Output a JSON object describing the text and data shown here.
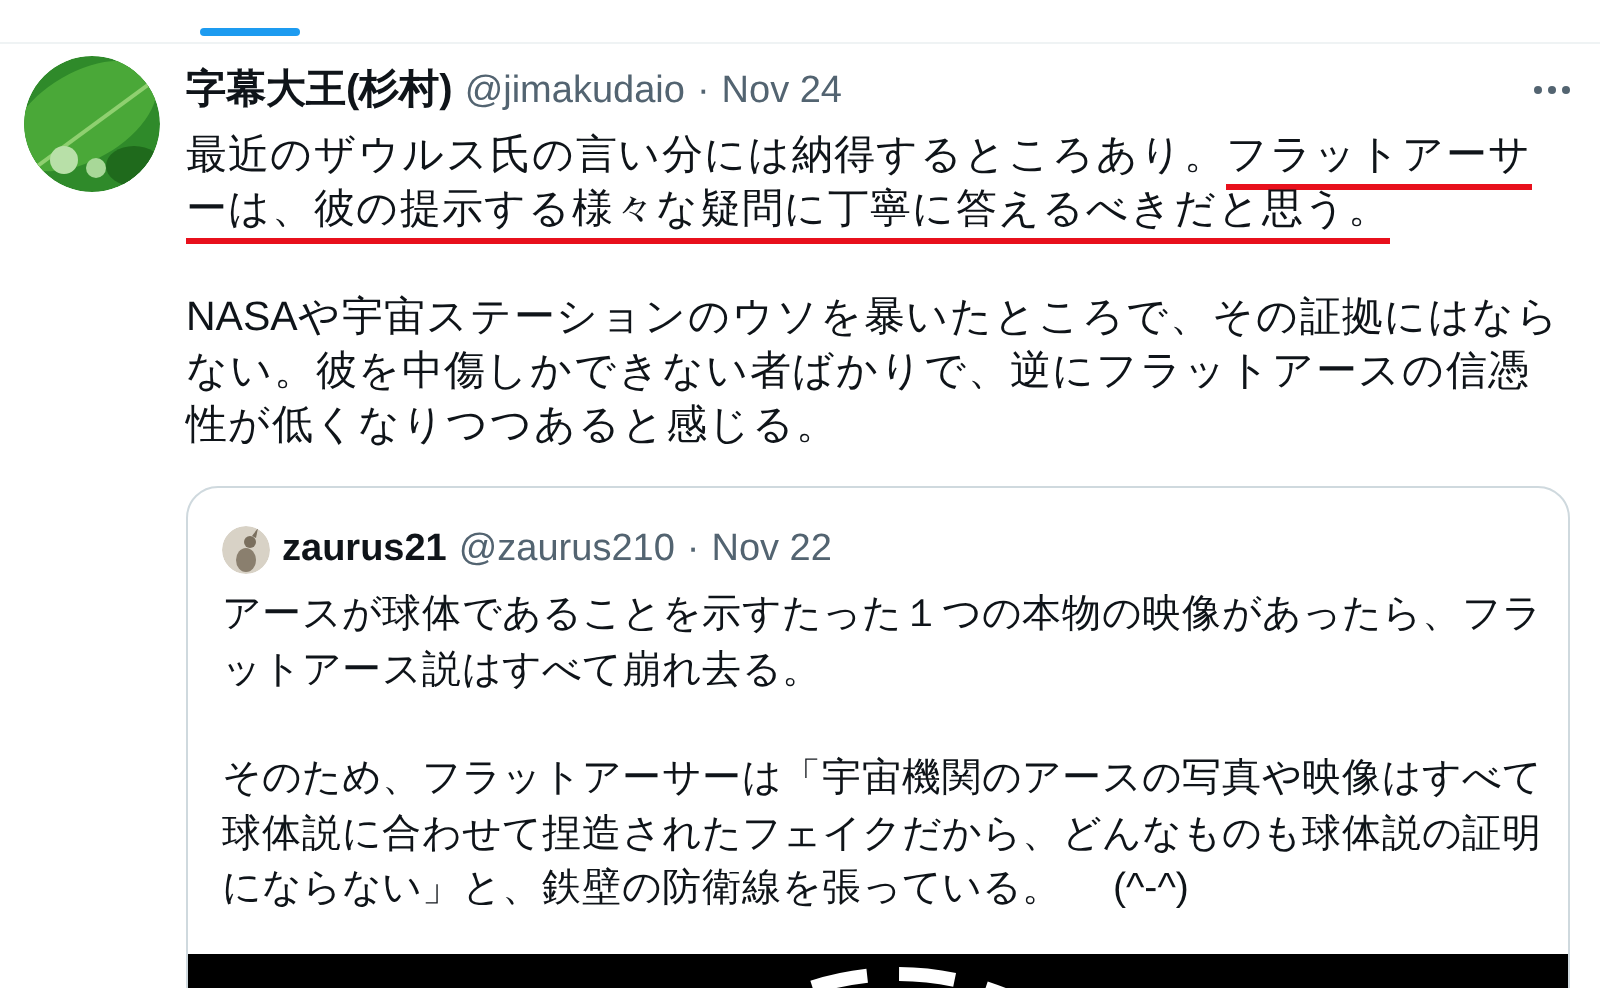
{
  "tweet": {
    "name": "字幕大王(杉村)",
    "handle": "@jimakudaio",
    "separator": "·",
    "date": "Nov 24",
    "paragraphs": [
      {
        "segments": [
          {
            "text": "最近のザウルス氏の言い分には納得するところあり。",
            "underlined": false
          },
          {
            "text": "フラットアーサーは、彼の提示する様々な疑問に丁寧に答えるべきだと思う。",
            "underlined": true
          }
        ]
      },
      {
        "segments": [
          {
            "text": "NASAや宇宙ステーションのウソを暴いたところで、その証拠にはならない。彼を中傷しかできない者ばかりで、逆にフラットアースの信憑性が低くなりつつあると感じる。",
            "underlined": false
          }
        ]
      }
    ]
  },
  "quote": {
    "name": "zaurus21",
    "handle": "@zaurus210",
    "separator": "·",
    "date": "Nov 22",
    "paragraphs": [
      "アースが球体であることを示すたった１つの本物の映像があったら、フラットアース説はすべて崩れ去る。",
      "そのため、フラットアーサーは「宇宙機関のアースの写真や映像はすべて球体説に合わせて捏造されたフェイクだから、どんなものも球体説の証明にならない」と、鉄壁の防衛線を張っている。　 (^-^)"
    ]
  }
}
